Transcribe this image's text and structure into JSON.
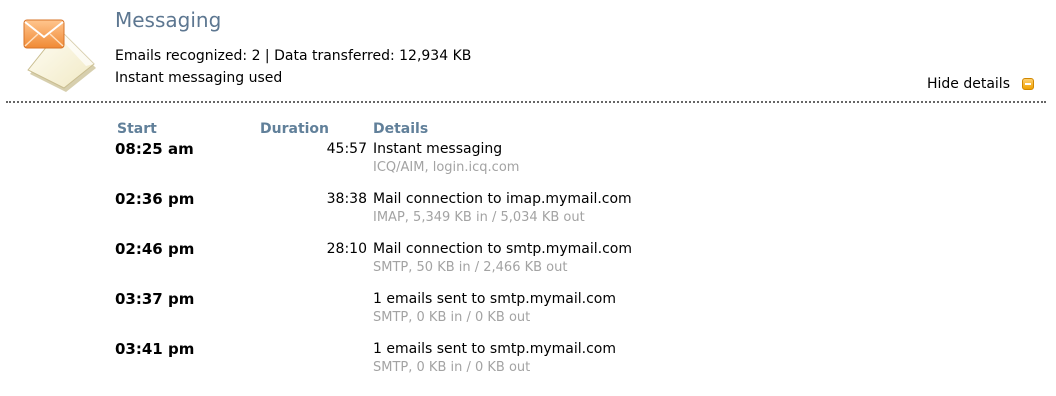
{
  "header": {
    "title": "Messaging",
    "summary_line1": "Emails recognized: 2 | Data transferred: 12,934 KB",
    "summary_line2": "Instant messaging used",
    "hide_details": "Hide details",
    "icon": "envelope-icon",
    "toggle_icon": "minus-icon"
  },
  "colors": {
    "title": "#5d7791",
    "column_header": "#61809a",
    "secondary_text": "#a3a3a3",
    "toggle_accent": "#f1a200"
  },
  "table": {
    "columns": [
      "Start",
      "Duration",
      "Details"
    ],
    "rows": [
      {
        "start": "08:25 am",
        "duration": "45:57",
        "detail": "Instant messaging",
        "sub": "ICQ/AIM, login.icq.com"
      },
      {
        "start": "02:36 pm",
        "duration": "38:38",
        "detail": "Mail connection to imap.mymail.com",
        "sub": "IMAP, 5,349 KB in / 5,034 KB out"
      },
      {
        "start": "02:46 pm",
        "duration": "28:10",
        "detail": "Mail connection to smtp.mymail.com",
        "sub": "SMTP, 50 KB in / 2,466 KB out"
      },
      {
        "start": "03:37 pm",
        "duration": "",
        "detail": "1 emails sent to smtp.mymail.com",
        "sub": "SMTP, 0 KB in / 0 KB out"
      },
      {
        "start": "03:41 pm",
        "duration": "",
        "detail": "1 emails sent to smtp.mymail.com",
        "sub": "SMTP, 0 KB in / 0 KB out"
      }
    ]
  }
}
